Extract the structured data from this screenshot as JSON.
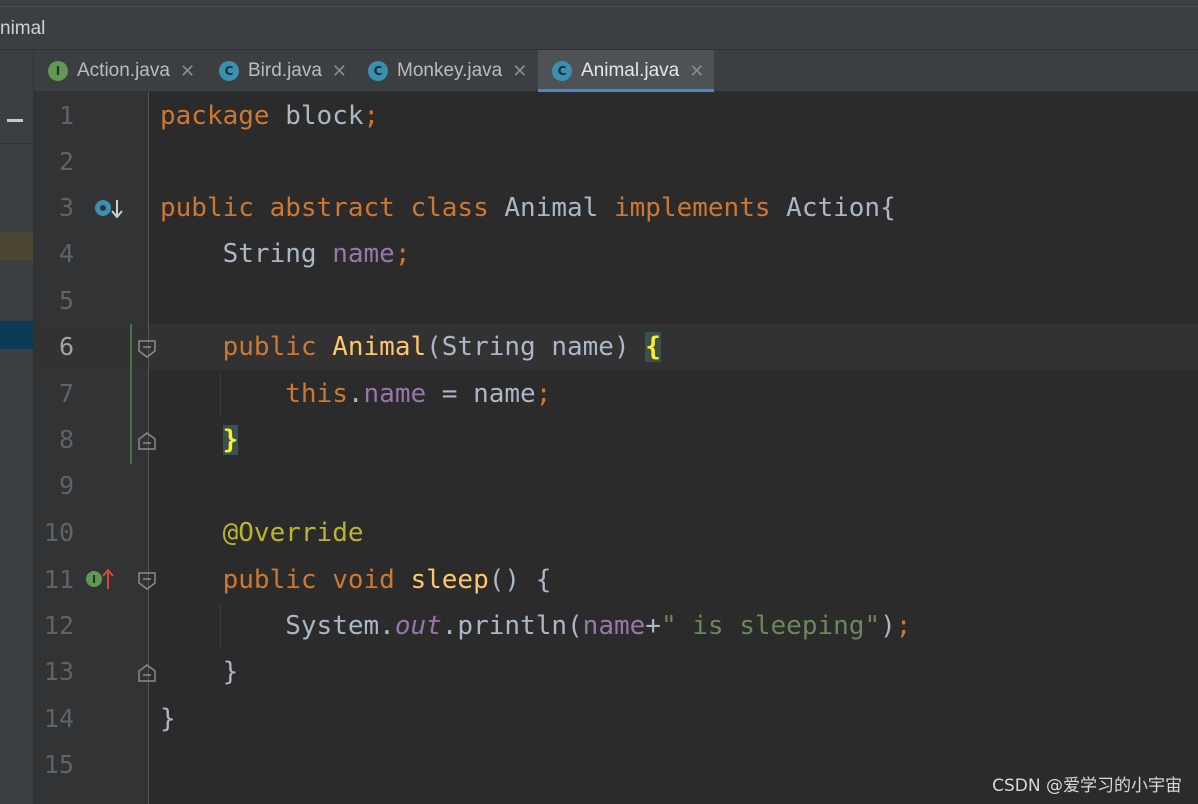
{
  "window": {
    "title": "nimal"
  },
  "tabs": [
    {
      "label": "Action.java",
      "icon": "I",
      "kind": "interface"
    },
    {
      "label": "Bird.java",
      "icon": "C",
      "kind": "class"
    },
    {
      "label": "Monkey.java",
      "icon": "C",
      "kind": "class"
    },
    {
      "label": "Animal.java",
      "icon": "C",
      "kind": "class",
      "active": true
    }
  ],
  "editor": {
    "line_numbers": [
      "1",
      "2",
      "3",
      "4",
      "5",
      "6",
      "7",
      "8",
      "9",
      "10",
      "11",
      "12",
      "13",
      "14",
      "15"
    ],
    "current_line": "6",
    "code": {
      "l1_kw": "package",
      "l1_rest": " block",
      "l1_semi": ";",
      "l3_kw": "public abstract class",
      "l3_name": " Animal ",
      "l3_kw2": "implements",
      "l3_rest": " Action{",
      "l4_type": "String ",
      "l4_field": "name",
      "l4_semi": ";",
      "l6_kw": "public ",
      "l6_fn": "Animal",
      "l6_params": "(String name) ",
      "l6_brace": "{",
      "l7_kw": "this",
      "l7_dot": ".",
      "l7_field": "name",
      "l7_rest": " = name",
      "l7_semi": ";",
      "l8_brace": "}",
      "l10_ann": "@Override",
      "l11_kw": "public void ",
      "l11_fn": "sleep",
      "l11_rest": "() {",
      "l12_sys": "System.",
      "l12_out": "out",
      "l12_mid": ".println(",
      "l12_field": "name",
      "l12_plus": "+",
      "l12_str": "\" is sleeping\"",
      "l12_close": ")",
      "l12_semi": ";",
      "l13_brace": "}",
      "l14_brace": "}"
    }
  },
  "watermark": "CSDN @爱学习的小宇宙",
  "colors": {
    "keyword": "#cc7832",
    "field": "#9876aa",
    "string": "#6a8759",
    "annotation": "#bbb529",
    "method": "#ffc66d",
    "text": "#a9b7c6",
    "accent": "#4a88c7"
  }
}
